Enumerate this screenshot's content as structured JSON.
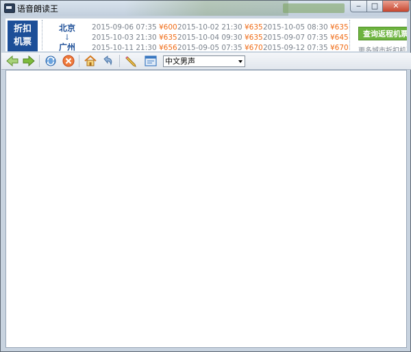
{
  "window": {
    "title": "语音朗读王",
    "buttons": {
      "minimize": "‒",
      "maximize": "□",
      "close": "✕"
    }
  },
  "banner": {
    "badge": [
      "折扣",
      "机票"
    ],
    "route_from": "北京",
    "route_arrow": "↓",
    "route_to": "广州",
    "fares": [
      {
        "date": "2015-09-06 07:35",
        "price": "¥600"
      },
      {
        "date": "2015-10-02 21:30",
        "price": "¥635"
      },
      {
        "date": "2015-10-05 08:30",
        "price": "¥635"
      },
      {
        "date": "2015-10-03 21:30",
        "price": "¥635"
      },
      {
        "date": "2015-10-04 09:30",
        "price": "¥635"
      },
      {
        "date": "2015-09-07 07:35",
        "price": "¥645"
      },
      {
        "date": "2015-10-11 21:30",
        "price": "¥656"
      },
      {
        "date": "2015-09-05 07:35",
        "price": "¥670"
      },
      {
        "date": "2015-09-12 07:35",
        "price": "¥670"
      }
    ],
    "query_button": "查询返程机票",
    "query_sub": "更多城市折扣机票"
  },
  "toolbar": {
    "voice_selected": "中文男声",
    "icons": [
      "back-icon",
      "forward-icon",
      "refresh-icon",
      "stop-icon",
      "home-icon",
      "undo-icon",
      "pen-icon",
      "window-icon"
    ],
    "colors": {
      "nav_green": "#7dbb3c",
      "stop_red": "#e05a2a",
      "refresh_blue": "#3a7cc6"
    }
  },
  "colors": {
    "badge_blue": "#1d4f98",
    "price_orange": "#ef6a14",
    "query_green": "#6db33f"
  }
}
